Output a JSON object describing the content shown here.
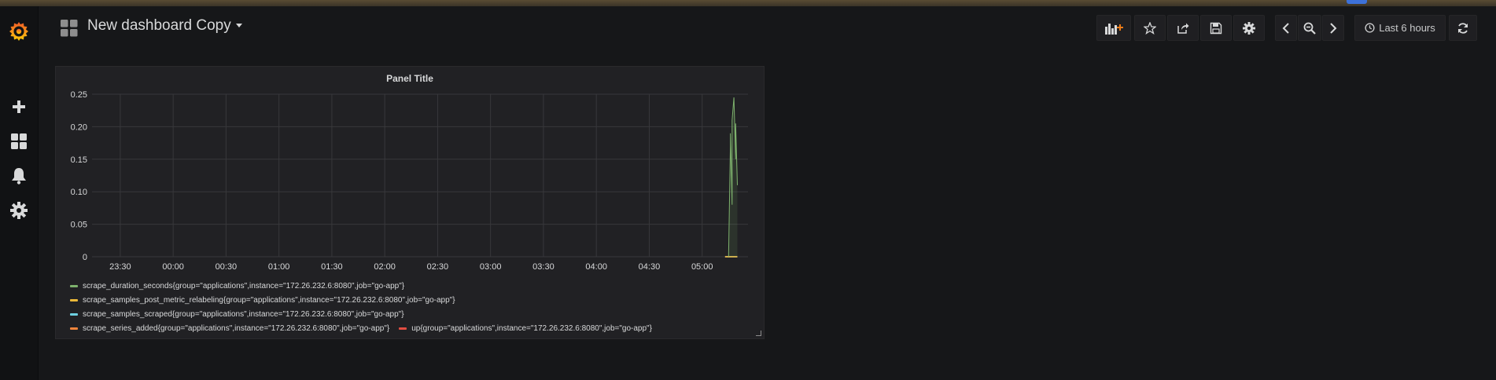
{
  "dashboard": {
    "title": "New dashboard Copy"
  },
  "toolbar": {
    "add_panel_icon": "add-panel-icon",
    "star_icon": "star-icon",
    "share_icon": "share-icon",
    "save_icon": "save-icon",
    "settings_icon": "gear-icon",
    "time_back_icon": "chevron-left-icon",
    "zoom_icon": "zoom-out-icon",
    "time_forward_icon": "chevron-right-icon",
    "time_range_label": "Last 6 hours",
    "refresh_icon": "refresh-icon"
  },
  "sidebar": {
    "items": [
      {
        "name": "grafana-logo",
        "icon": "grafana-logo"
      },
      {
        "name": "create",
        "icon": "plus-icon"
      },
      {
        "name": "dashboards",
        "icon": "dashboards-icon"
      },
      {
        "name": "alerting",
        "icon": "bell-icon"
      },
      {
        "name": "configuration",
        "icon": "gear-icon"
      }
    ]
  },
  "panel": {
    "title": "Panel Title"
  },
  "colors": {
    "green": "#7eb26d",
    "yellow": "#eab839",
    "cyan": "#6ed0e0",
    "orange": "#ef843c",
    "red": "#e24d42"
  },
  "chart_data": {
    "type": "line",
    "title": "Panel Title",
    "xlabel": "",
    "ylabel": "",
    "x_ticks": [
      "23:30",
      "00:00",
      "00:30",
      "01:00",
      "01:30",
      "02:00",
      "02:30",
      "03:00",
      "03:30",
      "04:00",
      "04:30",
      "05:00"
    ],
    "y_ticks": [
      "0",
      "0.05",
      "0.10",
      "0.15",
      "0.20",
      "0.25"
    ],
    "ylim": [
      0,
      0.25
    ],
    "xlim": [
      "23:14",
      "05:26"
    ],
    "grid": true,
    "legend_position": "bottom",
    "series": [
      {
        "name": "scrape_duration_seconds{group=\"applications\",instance=\"172.26.232.6:8080\",job=\"go-app\"}",
        "color": "#7eb26d",
        "points": [
          [
            "05:15",
            0
          ],
          [
            "05:16",
            0.17
          ],
          [
            "05:16",
            0.19
          ],
          [
            "05:17",
            0.08
          ],
          [
            "05:17",
            0.21
          ],
          [
            "05:18",
            0.245
          ],
          [
            "05:19",
            0.15
          ],
          [
            "05:19",
            0.205
          ],
          [
            "05:20",
            0.11
          ]
        ]
      },
      {
        "name": "scrape_samples_post_metric_relabeling{group=\"applications\",instance=\"172.26.232.6:8080\",job=\"go-app\"}",
        "color": "#eab839",
        "points": [
          [
            "05:13",
            0
          ],
          [
            "05:20",
            0
          ]
        ]
      },
      {
        "name": "scrape_samples_scraped{group=\"applications\",instance=\"172.26.232.6:8080\",job=\"go-app\"}",
        "color": "#6ed0e0",
        "points": [
          [
            "05:13",
            0
          ],
          [
            "05:20",
            0
          ]
        ]
      },
      {
        "name": "scrape_series_added{group=\"applications\",instance=\"172.26.232.6:8080\",job=\"go-app\"}",
        "color": "#ef843c",
        "points": [
          [
            "05:13",
            0
          ],
          [
            "05:20",
            0
          ]
        ]
      },
      {
        "name": "up{group=\"applications\",instance=\"172.26.232.6:8080\",job=\"go-app\"}",
        "color": "#e24d42",
        "points": [
          [
            "05:13",
            0
          ],
          [
            "05:20",
            0
          ]
        ]
      }
    ]
  }
}
